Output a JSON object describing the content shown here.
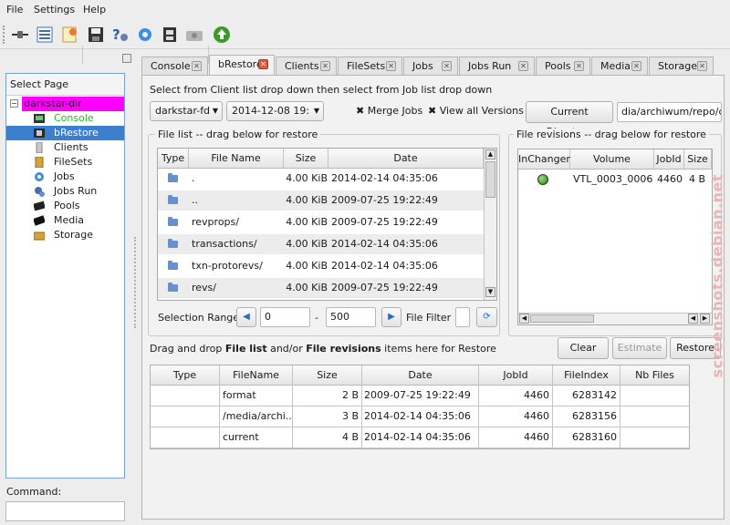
{
  "menu": {
    "file": "File",
    "settings": "Settings",
    "help": "Help"
  },
  "toolbar_icons": [
    "connect-icon",
    "list-icon",
    "label-icon",
    "save-icon",
    "help-icon",
    "gear-icon",
    "film-icon",
    "camera-icon",
    "go-icon"
  ],
  "sidebar": {
    "title": "Select Page",
    "root": "darkstar-dir",
    "items": [
      {
        "label": "Console",
        "icon": "console-icon"
      },
      {
        "label": "bRestore",
        "icon": "restore-icon"
      },
      {
        "label": "Clients",
        "icon": "clients-icon"
      },
      {
        "label": "FileSets",
        "icon": "filesets-icon"
      },
      {
        "label": "Jobs",
        "icon": "jobs-icon"
      },
      {
        "label": "Jobs Run",
        "icon": "jobsrun-icon"
      },
      {
        "label": "Pools",
        "icon": "pools-icon"
      },
      {
        "label": "Media",
        "icon": "media-icon"
      },
      {
        "label": "Storage",
        "icon": "storage-icon"
      }
    ]
  },
  "command": {
    "label": "Command:",
    "value": ""
  },
  "tabs": [
    {
      "label": "Console"
    },
    {
      "label": "bRestore"
    },
    {
      "label": "Clients"
    },
    {
      "label": "FileSets"
    },
    {
      "label": "Jobs"
    },
    {
      "label": "Jobs Run"
    },
    {
      "label": "Pools"
    },
    {
      "label": "Media"
    },
    {
      "label": "Storage"
    }
  ],
  "restore": {
    "instruction": "Select from Client list drop down then select from Job list drop down",
    "client": "darkstar-fd",
    "job": "2014-12-08 19:",
    "merge_jobs": "Merge Jobs",
    "view_all_versions": "View all Versions",
    "current_directory_button": "Current Directory",
    "current_directory": "dia/archiwum/repo/db/",
    "file_list_title": "File list -- drag below for restore",
    "file_list_columns": [
      "Type",
      "File Name",
      "Size",
      "Date"
    ],
    "file_list": [
      {
        "name": ".",
        "size": "4.00 KiB",
        "date": "2014-02-14 04:35:06"
      },
      {
        "name": "..",
        "size": "4.00 KiB",
        "date": "2009-07-25 19:22:49"
      },
      {
        "name": "revprops/",
        "size": "4.00 KiB",
        "date": "2009-07-25 19:22:49"
      },
      {
        "name": "transactions/",
        "size": "4.00 KiB",
        "date": "2014-02-14 04:35:06"
      },
      {
        "name": "txn-protorevs/",
        "size": "4.00 KiB",
        "date": "2014-02-14 04:35:06"
      },
      {
        "name": "revs/",
        "size": "4.00 KiB",
        "date": "2009-07-25 19:22:49"
      }
    ],
    "file_revisions_title": "File revisions -- drag below for restore",
    "revision_columns": [
      "InChanger",
      "Volume",
      "JobId",
      "Size"
    ],
    "revisions": [
      {
        "volume": "VTL_0003_0006",
        "jobid": "4460",
        "size": "4 B"
      }
    ],
    "selection_range_label": "Selection Range",
    "range_from": "0",
    "range_dash": "-",
    "range_to": "500",
    "file_filter_label": "File Filter",
    "drop_instruction_pre": "Drag and drop ",
    "drop_instruction_b1": "File list",
    "drop_instruction_mid": " and/or ",
    "drop_instruction_b2": "File revisions",
    "drop_instruction_post": " items here for Restore",
    "clear_button": "Clear",
    "estimate_button": "Estimate",
    "restore_button": "Restore",
    "restore_columns": [
      "Type",
      "FileName",
      "Size",
      "Date",
      "JobId",
      "FileIndex",
      "Nb Files"
    ],
    "restore_rows": [
      {
        "filename": "format",
        "size": "2 B",
        "date": "2009-07-25 19:22:49",
        "jobid": "4460",
        "fileindex": "6283142"
      },
      {
        "filename": "/media/archi...",
        "size": "3 B",
        "date": "2014-02-14 04:35:06",
        "jobid": "4460",
        "fileindex": "6283156"
      },
      {
        "filename": "current",
        "size": "4 B",
        "date": "2014-02-14 04:35:06",
        "jobid": "4460",
        "fileindex": "6283160"
      }
    ]
  },
  "watermark": "screenshots.debian.net",
  "colors": {
    "selection": "#3d7fcf",
    "root_highlight": "#ff00ff",
    "console_text": "#21c21e"
  }
}
